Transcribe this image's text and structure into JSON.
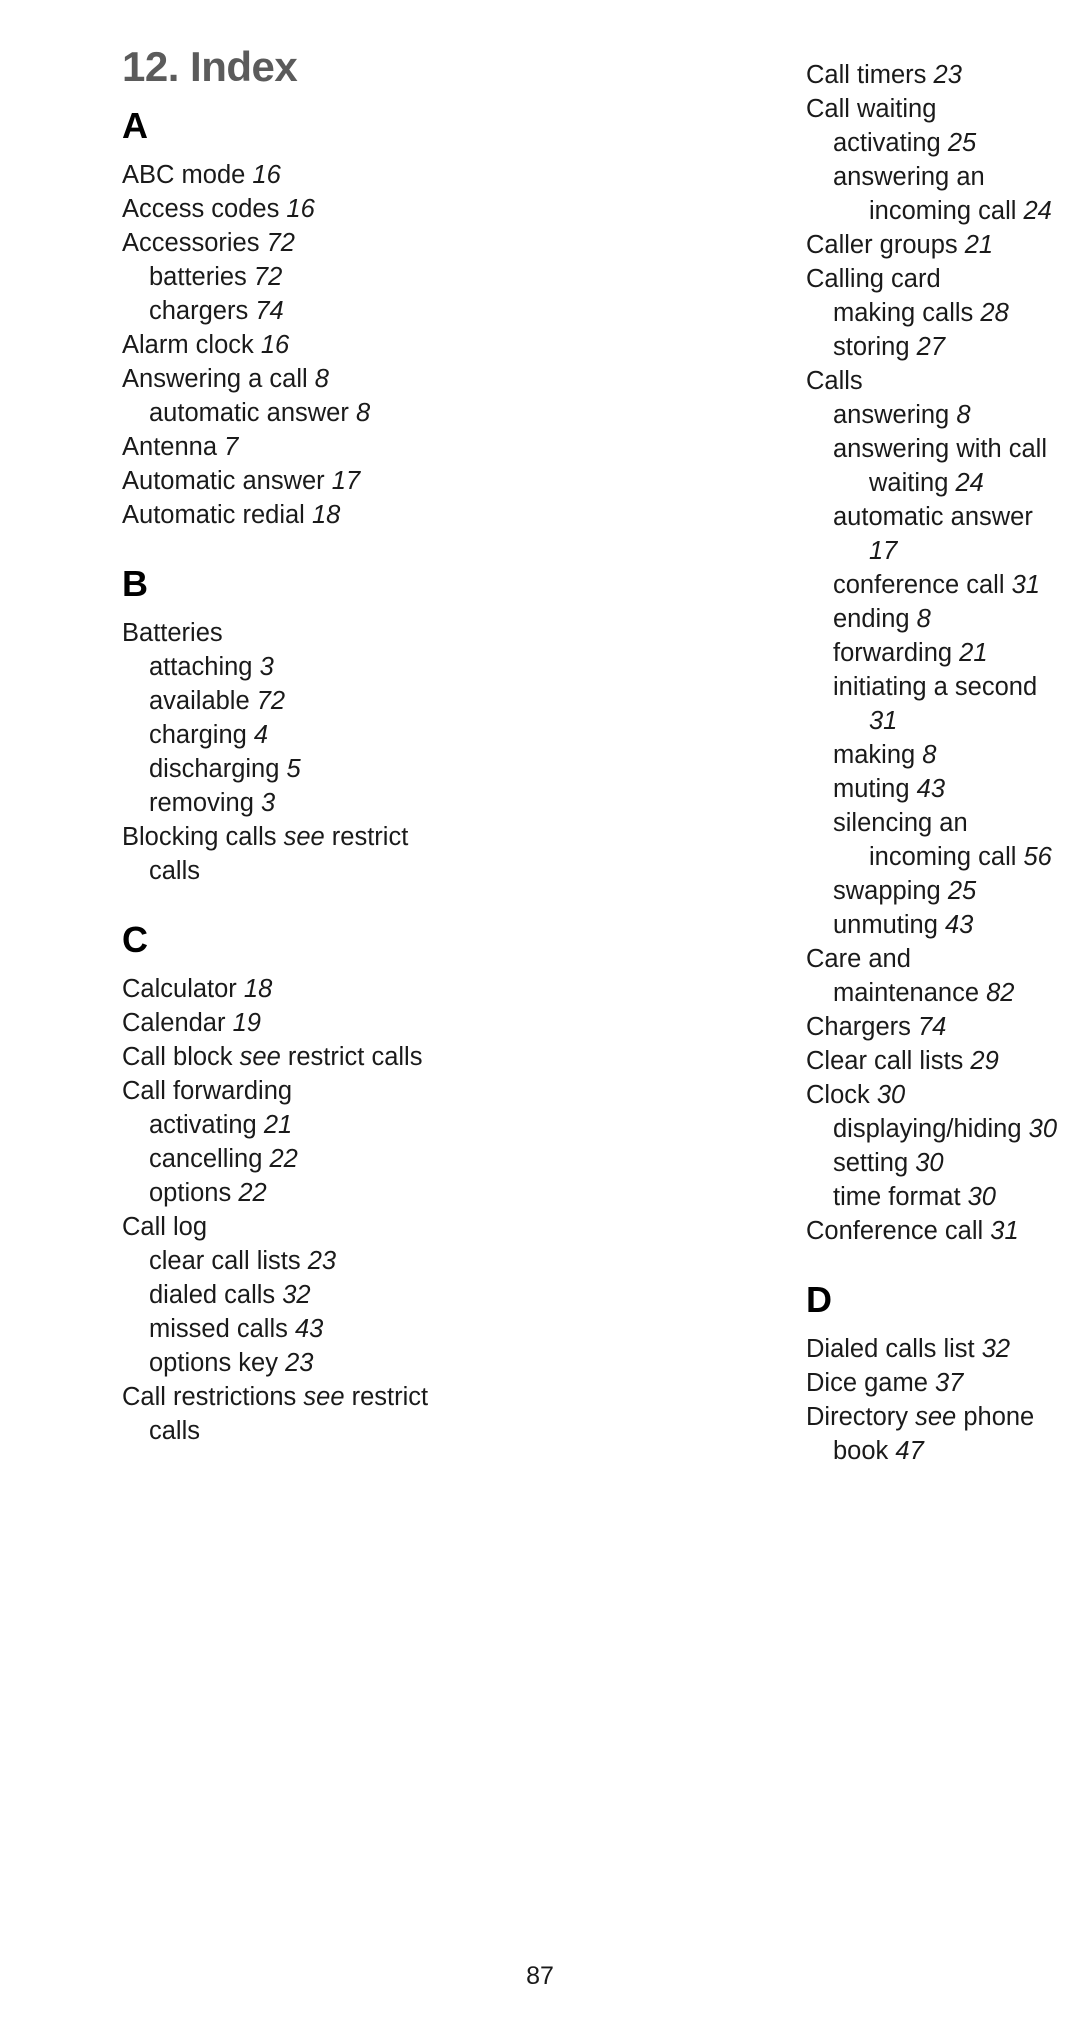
{
  "page": {
    "chapter_title": "12. Index",
    "folio": "87"
  },
  "columns": {
    "left": [
      {
        "letter": "A",
        "entries": [
          {
            "level": 0,
            "text": "ABC mode",
            "page": "16"
          },
          {
            "level": 0,
            "text": "Access codes",
            "page": "16"
          },
          {
            "level": 0,
            "text": "Accessories",
            "page": "72"
          },
          {
            "level": 1,
            "text": "batteries",
            "page": "72"
          },
          {
            "level": 1,
            "text": "chargers",
            "page": "74"
          },
          {
            "level": 0,
            "text": "Alarm clock",
            "page": "16"
          },
          {
            "level": 0,
            "text": "Answering a call",
            "page": "8"
          },
          {
            "level": 1,
            "text": "automatic answer",
            "page": "8"
          },
          {
            "level": 0,
            "text": "Antenna",
            "page": "7"
          },
          {
            "level": 0,
            "text": "Automatic answer",
            "page": "17"
          },
          {
            "level": 0,
            "text": "Automatic redial",
            "page": "18"
          }
        ]
      },
      {
        "letter": "B",
        "entries": [
          {
            "level": 0,
            "text": "Batteries",
            "page": ""
          },
          {
            "level": 1,
            "text": "attaching",
            "page": "3"
          },
          {
            "level": 1,
            "text": "available",
            "page": "72"
          },
          {
            "level": 1,
            "text": "charging",
            "page": "4"
          },
          {
            "level": 1,
            "text": "discharging",
            "page": "5"
          },
          {
            "level": 1,
            "text": "removing",
            "page": "3"
          },
          {
            "level": 0,
            "text": "Blocking calls",
            "see": "see",
            "see_target": "restrict calls",
            "page": ""
          }
        ]
      },
      {
        "letter": "C",
        "entries": [
          {
            "level": 0,
            "text": "Calculator",
            "page": "18"
          },
          {
            "level": 0,
            "text": "Calendar",
            "page": "19"
          },
          {
            "level": 0,
            "text": "Call block",
            "see": "see",
            "see_target": "restrict calls",
            "page": ""
          },
          {
            "level": 0,
            "text": "Call forwarding",
            "page": ""
          },
          {
            "level": 1,
            "text": "activating",
            "page": "21"
          },
          {
            "level": 1,
            "text": "cancelling",
            "page": "22"
          },
          {
            "level": 1,
            "text": "options",
            "page": "22"
          },
          {
            "level": 0,
            "text": "Call log",
            "page": ""
          },
          {
            "level": 1,
            "text": "clear call lists",
            "page": "23"
          },
          {
            "level": 1,
            "text": "dialed calls",
            "page": "32"
          },
          {
            "level": 1,
            "text": "missed calls",
            "page": "43"
          },
          {
            "level": 1,
            "text": "options key",
            "page": "23"
          },
          {
            "level": 0,
            "text": "Call restrictions",
            "see": "see",
            "see_target": "restrict calls",
            "page": ""
          }
        ]
      }
    ],
    "right": [
      {
        "letter": "",
        "entries": [
          {
            "level": 0,
            "text": "Call timers",
            "page": "23"
          },
          {
            "level": 0,
            "text": "Call waiting",
            "page": ""
          },
          {
            "level": 1,
            "text": "activating",
            "page": "25"
          },
          {
            "level": 1,
            "text": "answering an incoming call",
            "page": "24"
          },
          {
            "level": 0,
            "text": "Caller groups",
            "page": "21"
          },
          {
            "level": 0,
            "text": "Calling card",
            "page": ""
          },
          {
            "level": 1,
            "text": "making calls",
            "page": "28"
          },
          {
            "level": 1,
            "text": "storing",
            "page": "27"
          },
          {
            "level": 0,
            "text": "Calls",
            "page": ""
          },
          {
            "level": 1,
            "text": "answering",
            "page": "8"
          },
          {
            "level": 1,
            "text": "answering with call waiting",
            "page": "24"
          },
          {
            "level": 1,
            "text": "automatic answer",
            "page": "17"
          },
          {
            "level": 1,
            "text": "conference call",
            "page": "31"
          },
          {
            "level": 1,
            "text": "ending",
            "page": "8"
          },
          {
            "level": 1,
            "text": "forwarding",
            "page": "21"
          },
          {
            "level": 1,
            "text": "initiating a second",
            "page": "31"
          },
          {
            "level": 1,
            "text": "making",
            "page": "8"
          },
          {
            "level": 1,
            "text": "muting",
            "page": "43"
          },
          {
            "level": 1,
            "text": "silencing an incoming call",
            "page": "56"
          },
          {
            "level": 1,
            "text": "swapping",
            "page": "25"
          },
          {
            "level": 1,
            "text": "unmuting",
            "page": "43"
          },
          {
            "level": 0,
            "text": "Care and maintenance",
            "page": "82"
          },
          {
            "level": 0,
            "text": "Chargers",
            "page": "74"
          },
          {
            "level": 0,
            "text": "Clear call lists",
            "page": "29"
          },
          {
            "level": 0,
            "text": "Clock",
            "page": "30"
          },
          {
            "level": 1,
            "text": "displaying/hiding",
            "page": "30"
          },
          {
            "level": 1,
            "text": "setting",
            "page": "30"
          },
          {
            "level": 1,
            "text": "time format",
            "page": "30"
          },
          {
            "level": 0,
            "text": "Conference call",
            "page": "31"
          }
        ]
      },
      {
        "letter": "D",
        "entries": [
          {
            "level": 0,
            "text": "Dialed calls list",
            "page": "32"
          },
          {
            "level": 0,
            "text": "Dice game",
            "page": "37"
          },
          {
            "level": 0,
            "text": "Directory",
            "see": "see",
            "see_target": "phone book",
            "page": "47"
          }
        ]
      }
    ]
  }
}
